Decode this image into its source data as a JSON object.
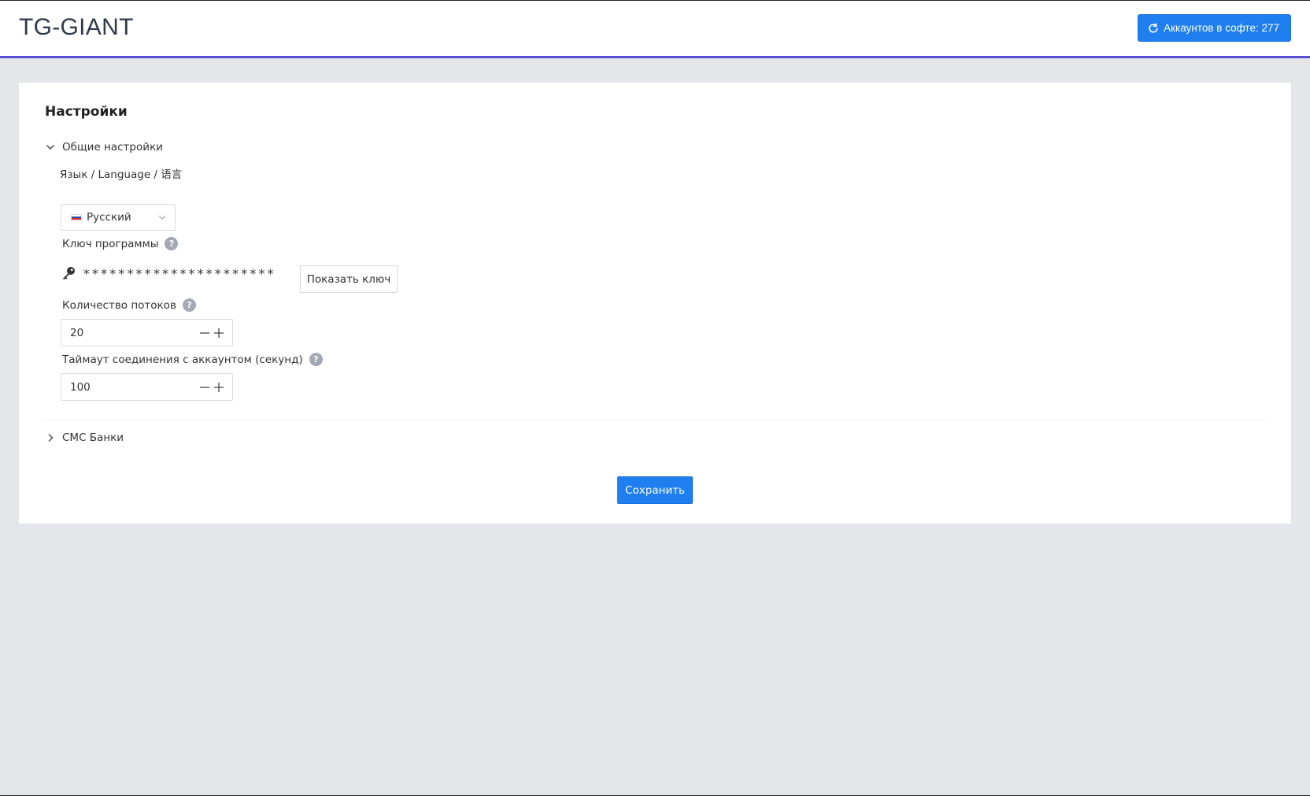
{
  "header": {
    "logo": "TG-GIANT",
    "accounts_button": "Аккаунтов в софте: 277",
    "accent_color": "#5b4fd1",
    "primary_color": "#1f7ff0"
  },
  "settings": {
    "title": "Настройки",
    "general_section": {
      "label": "Общие настройки",
      "expanded": true,
      "language": {
        "label": "Язык / Language / 语言",
        "selected": "Русский"
      },
      "program_key": {
        "label": "Ключ программы",
        "masked_value": "**********************",
        "show_button": "Показать ключ"
      },
      "threads": {
        "label": "Количество потоков",
        "value": "20"
      },
      "timeout": {
        "label": "Таймаут соединения с аккаунтом (секунд)",
        "value": "100"
      }
    },
    "sms_section": {
      "label": "СМС Банки",
      "expanded": false
    },
    "save_button": "Сохранить"
  }
}
